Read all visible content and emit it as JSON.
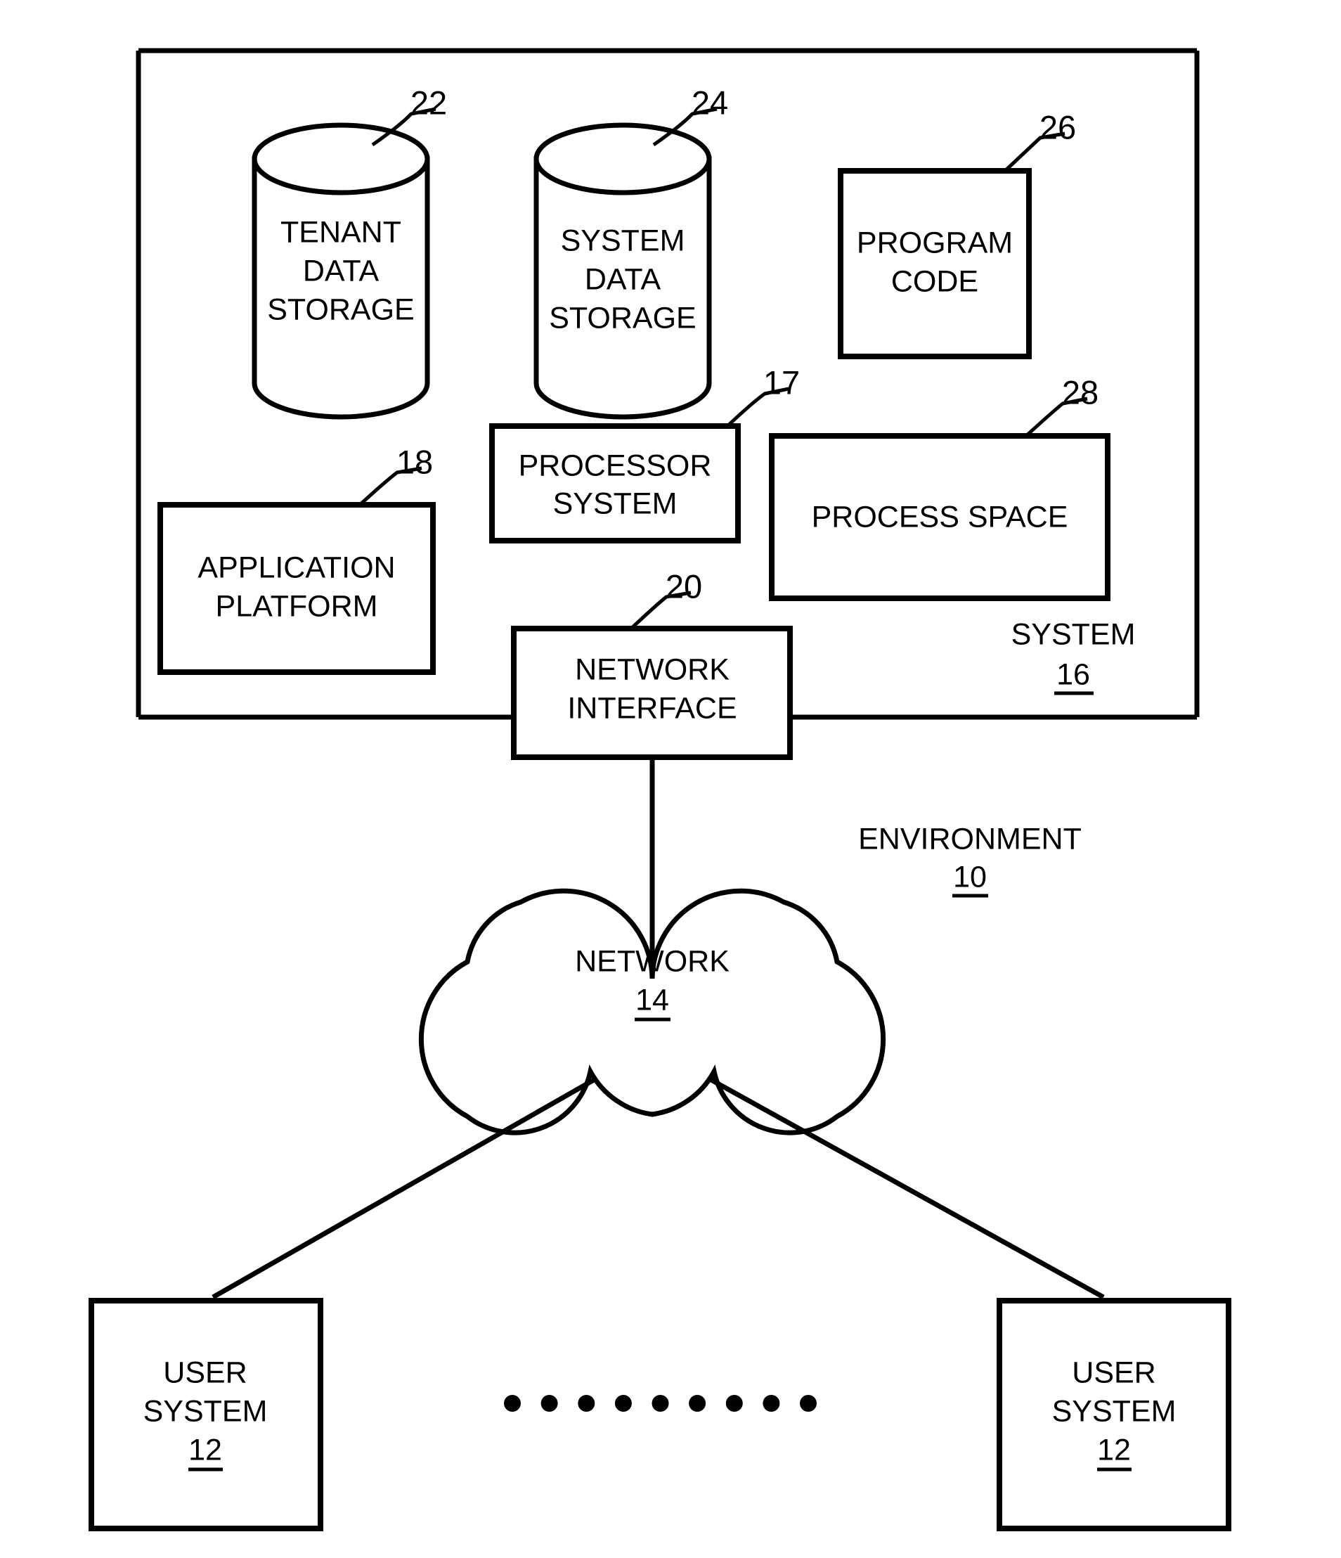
{
  "figure": {
    "title": "Environment block diagram",
    "line_color": "#000000",
    "background_color": "#ffffff"
  },
  "system_container": {
    "name": "SYSTEM",
    "label": "SYSTEM",
    "ref": "16"
  },
  "environment": {
    "label": "ENVIRONMENT",
    "ref": "10"
  },
  "nodes": {
    "tenant_data_storage": {
      "shape": "cylinder",
      "line1": "TENANT",
      "line2": "DATA",
      "line3": "STORAGE",
      "ref": "22"
    },
    "system_data_storage": {
      "shape": "cylinder",
      "line1": "SYSTEM",
      "line2": "DATA",
      "line3": "STORAGE",
      "ref": "24"
    },
    "program_code": {
      "shape": "rectangle",
      "line1": "PROGRAM",
      "line2": "CODE",
      "ref": "26"
    },
    "processor_system": {
      "shape": "rectangle",
      "line1": "PROCESSOR",
      "line2": "SYSTEM",
      "ref": "17"
    },
    "process_space": {
      "shape": "rectangle",
      "line1": "PROCESS SPACE",
      "ref": "28"
    },
    "application_platform": {
      "shape": "rectangle",
      "line1": "APPLICATION",
      "line2": "PLATFORM",
      "ref": "18"
    },
    "network_interface": {
      "shape": "rectangle",
      "line1": "NETWORK",
      "line2": "INTERFACE",
      "ref": "20"
    },
    "network_cloud": {
      "shape": "cloud",
      "line1": "NETWORK",
      "ref": "14"
    },
    "user_system_left": {
      "shape": "rectangle",
      "line1": "USER",
      "line2": "SYSTEM",
      "ref": "12"
    },
    "user_system_right": {
      "shape": "rectangle",
      "line1": "USER",
      "line2": "SYSTEM",
      "ref": "12"
    }
  },
  "ellipsis": {
    "dot_count": 9,
    "meaning": "additional user systems"
  },
  "connections": [
    {
      "from": "network_interface",
      "to": "network_cloud"
    },
    {
      "from": "network_cloud",
      "to": "user_system_left"
    },
    {
      "from": "network_cloud",
      "to": "user_system_right"
    }
  ]
}
